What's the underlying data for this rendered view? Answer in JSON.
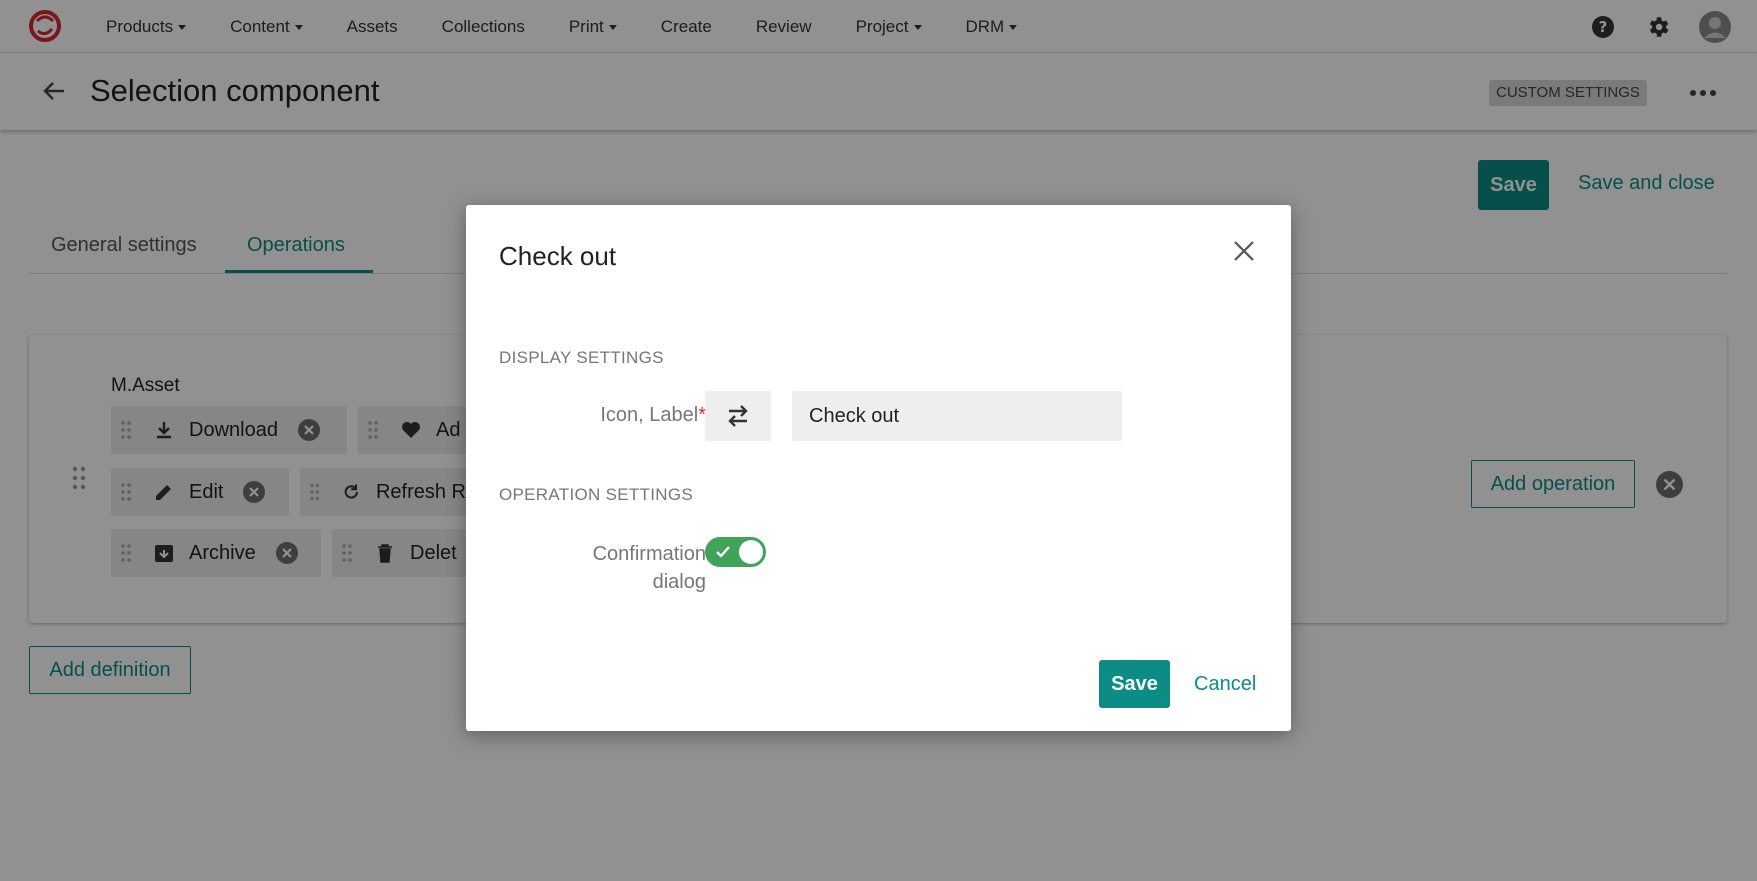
{
  "nav": {
    "items": [
      {
        "label": "Products",
        "dropdown": true
      },
      {
        "label": "Content",
        "dropdown": true
      },
      {
        "label": "Assets",
        "dropdown": false
      },
      {
        "label": "Collections",
        "dropdown": false
      },
      {
        "label": "Print",
        "dropdown": true
      },
      {
        "label": "Create",
        "dropdown": false
      },
      {
        "label": "Review",
        "dropdown": false
      },
      {
        "label": "Project",
        "dropdown": true
      },
      {
        "label": "DRM",
        "dropdown": true
      }
    ],
    "right_icons": [
      "help-icon",
      "gear-icon",
      "avatar-icon"
    ]
  },
  "header": {
    "title": "Selection component",
    "badge": "CUSTOM SETTINGS"
  },
  "actions": {
    "save": "Save",
    "save_and_close": "Save and close"
  },
  "tabs": [
    {
      "label": "General settings",
      "active": false
    },
    {
      "label": "Operations",
      "active": true
    }
  ],
  "definition": {
    "name": "M.Asset",
    "operations": [
      {
        "label": "Download",
        "icon": "download-icon"
      },
      {
        "label": "Ad",
        "icon": "heart-icon"
      },
      {
        "label": "Edit",
        "icon": "pencil-icon"
      },
      {
        "label": "Refresh R",
        "icon": "refresh-icon"
      },
      {
        "label": "Archive",
        "icon": "archive-icon"
      },
      {
        "label": "Delet",
        "icon": "trash-icon"
      }
    ],
    "add_operation": "Add operation"
  },
  "add_definition": "Add definition",
  "modal": {
    "title": "Check out",
    "display_settings_heading": "DISPLAY SETTINGS",
    "icon_label_label": "Icon, Label",
    "required_mark": "*",
    "label_value": "Check out",
    "operation_settings_heading": "OPERATION SETTINGS",
    "confirmation_label_line1": "Confirmation",
    "confirmation_label_line2": "dialog",
    "confirmation_enabled": true,
    "save": "Save",
    "cancel": "Cancel"
  },
  "colors": {
    "accent": "#0b8c85",
    "toggle_on": "#3fa35a",
    "required": "#d32f2f",
    "logo": "#d4282d"
  }
}
